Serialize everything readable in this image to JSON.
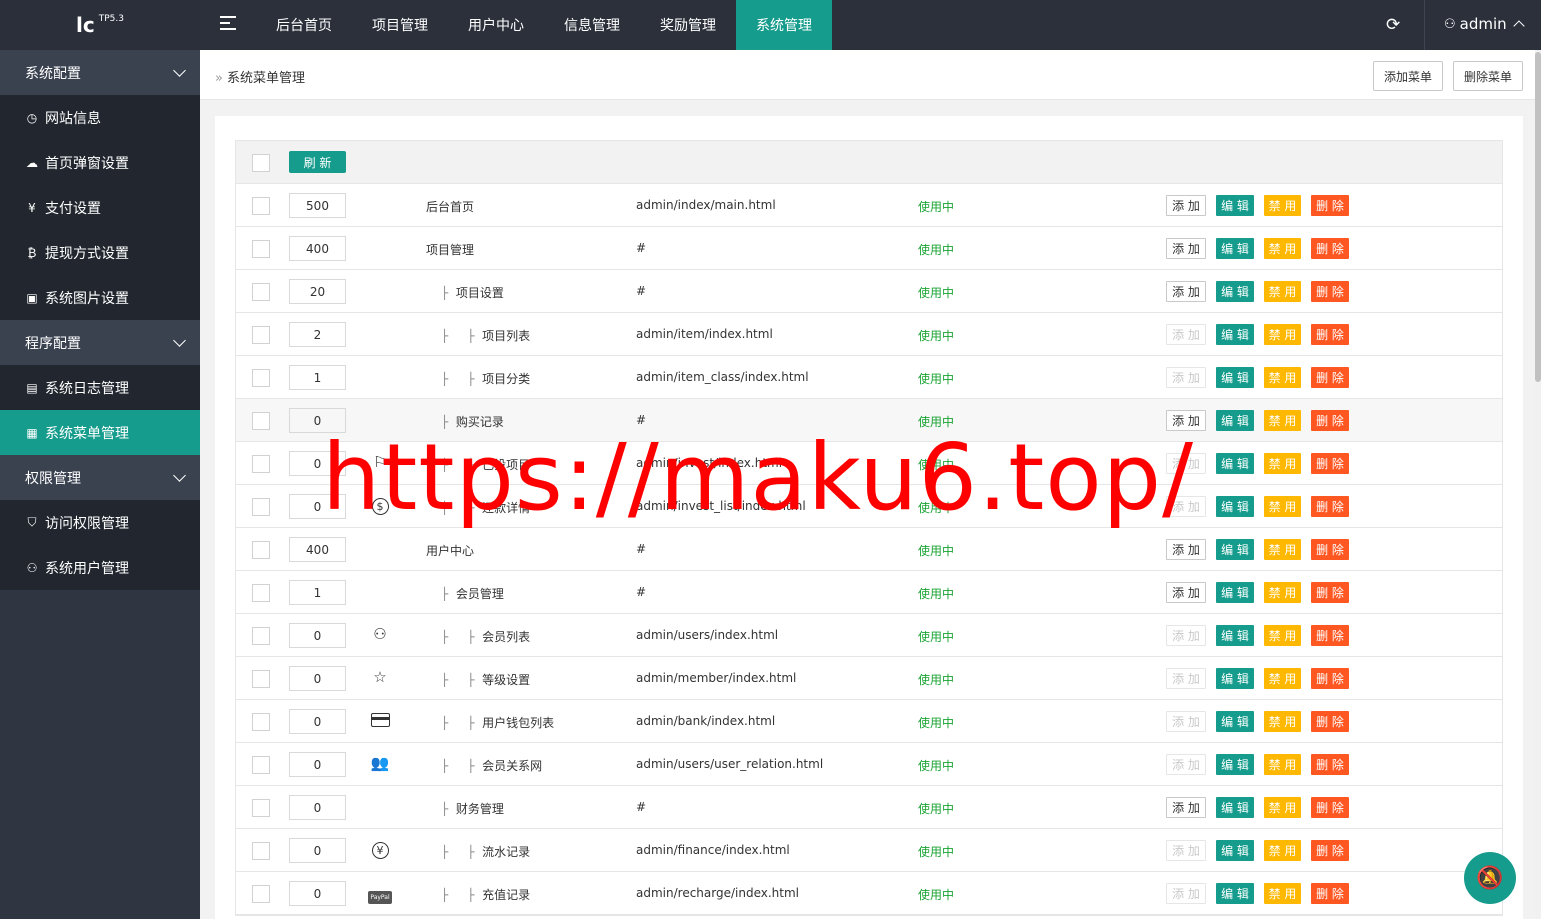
{
  "logo": {
    "text": "lc",
    "version": "TP5.3"
  },
  "sidebar": {
    "groups": [
      {
        "label": "系统配置",
        "items": [
          {
            "label": "网站信息",
            "icon": "dashboard-icon",
            "glyph": "◷"
          },
          {
            "label": "首页弹窗设置",
            "icon": "cloud-icon",
            "glyph": "☁"
          },
          {
            "label": "支付设置",
            "icon": "yen-icon",
            "glyph": "¥"
          },
          {
            "label": "提现方式设置",
            "icon": "bitcoin-icon",
            "glyph": "₿"
          },
          {
            "label": "系统图片设置",
            "icon": "image-icon",
            "glyph": "▣"
          }
        ]
      },
      {
        "label": "程序配置",
        "items": [
          {
            "label": "系统日志管理",
            "icon": "log-icon",
            "glyph": "▤"
          },
          {
            "label": "系统菜单管理",
            "icon": "menu-table-icon",
            "glyph": "▦",
            "active": true
          }
        ]
      },
      {
        "label": "权限管理",
        "items": [
          {
            "label": "访问权限管理",
            "icon": "shield-check-icon",
            "glyph": "⛉"
          },
          {
            "label": "系统用户管理",
            "icon": "user-icon",
            "glyph": "⚇"
          }
        ]
      }
    ]
  },
  "topnav": {
    "items": [
      "后台首页",
      "项目管理",
      "用户中心",
      "信息管理",
      "奖励管理",
      "系统管理"
    ],
    "active_index": 5,
    "user": "admin"
  },
  "crumb": {
    "title": "系统菜单管理",
    "add_label": "添加菜单",
    "delete_label": "删除菜单"
  },
  "table": {
    "refresh_label": "刷 新",
    "btn": {
      "add": "添 加",
      "edit": "编 辑",
      "ban": "禁 用",
      "del": "删 除"
    },
    "rows": [
      {
        "order": "500",
        "icon": "",
        "name": "后台首页",
        "level": 0,
        "url": "admin/index/main.html",
        "status": "使用中",
        "add_enabled": true
      },
      {
        "order": "400",
        "icon": "",
        "name": "项目管理",
        "level": 0,
        "url": "#",
        "status": "使用中",
        "add_enabled": true
      },
      {
        "order": "20",
        "icon": "",
        "name": "项目设置",
        "level": 1,
        "url": "#",
        "status": "使用中",
        "add_enabled": true
      },
      {
        "order": "2",
        "icon": "",
        "name": "项目列表",
        "level": 2,
        "url": "admin/item/index.html",
        "status": "使用中",
        "add_enabled": false
      },
      {
        "order": "1",
        "icon": "",
        "name": "项目分类",
        "level": 2,
        "url": "admin/item_class/index.html",
        "status": "使用中",
        "add_enabled": false
      },
      {
        "order": "0",
        "icon": "",
        "name": "购买记录",
        "level": 1,
        "url": "#",
        "status": "使用中",
        "add_enabled": true,
        "highlight": true
      },
      {
        "order": "0",
        "icon": "flag-icon",
        "glyph": "⚐",
        "name": "已投项目",
        "level": 2,
        "url": "admin/invest/index.html",
        "status": "使用中",
        "add_enabled": false
      },
      {
        "order": "0",
        "icon": "dollar-circle-icon",
        "glyph": "$",
        "name": "还款详情",
        "level": 2,
        "url": "admin/invest_list/index.html",
        "status": "使用中",
        "add_enabled": false
      },
      {
        "order": "400",
        "icon": "",
        "name": "用户中心",
        "level": 0,
        "url": "#",
        "status": "使用中",
        "add_enabled": true
      },
      {
        "order": "1",
        "icon": "",
        "name": "会员管理",
        "level": 1,
        "url": "#",
        "status": "使用中",
        "add_enabled": true
      },
      {
        "order": "0",
        "icon": "user-icon",
        "glyph": "⚇",
        "name": "会员列表",
        "level": 2,
        "url": "admin/users/index.html",
        "status": "使用中",
        "add_enabled": false
      },
      {
        "order": "0",
        "icon": "star-icon",
        "glyph": "☆",
        "name": "等级设置",
        "level": 2,
        "url": "admin/member/index.html",
        "status": "使用中",
        "add_enabled": false
      },
      {
        "order": "0",
        "icon": "credit-card-icon",
        "glyph": "▭",
        "name": "用户钱包列表",
        "level": 2,
        "url": "admin/bank/index.html",
        "status": "使用中",
        "add_enabled": false
      },
      {
        "order": "0",
        "icon": "users-icon",
        "glyph": "👥",
        "name": "会员关系网",
        "level": 2,
        "url": "admin/users/user_relation.html",
        "status": "使用中",
        "add_enabled": false
      },
      {
        "order": "0",
        "icon": "",
        "name": "财务管理",
        "level": 1,
        "url": "#",
        "status": "使用中",
        "add_enabled": true
      },
      {
        "order": "0",
        "icon": "yen-circle-icon",
        "glyph": "¥",
        "name": "流水记录",
        "level": 2,
        "url": "admin/finance/index.html",
        "status": "使用中",
        "add_enabled": false
      },
      {
        "order": "0",
        "icon": "paypal-icon",
        "glyph": "PayPal",
        "name": "充值记录",
        "level": 2,
        "url": "admin/recharge/index.html",
        "status": "使用中",
        "add_enabled": false
      }
    ]
  },
  "watermark": "https://maku6.top/",
  "colors": {
    "accent": "#169c8c",
    "warn": "#ffb800",
    "danger": "#ff5722",
    "status": "#1aa333",
    "sidebar": "#2f3541"
  }
}
